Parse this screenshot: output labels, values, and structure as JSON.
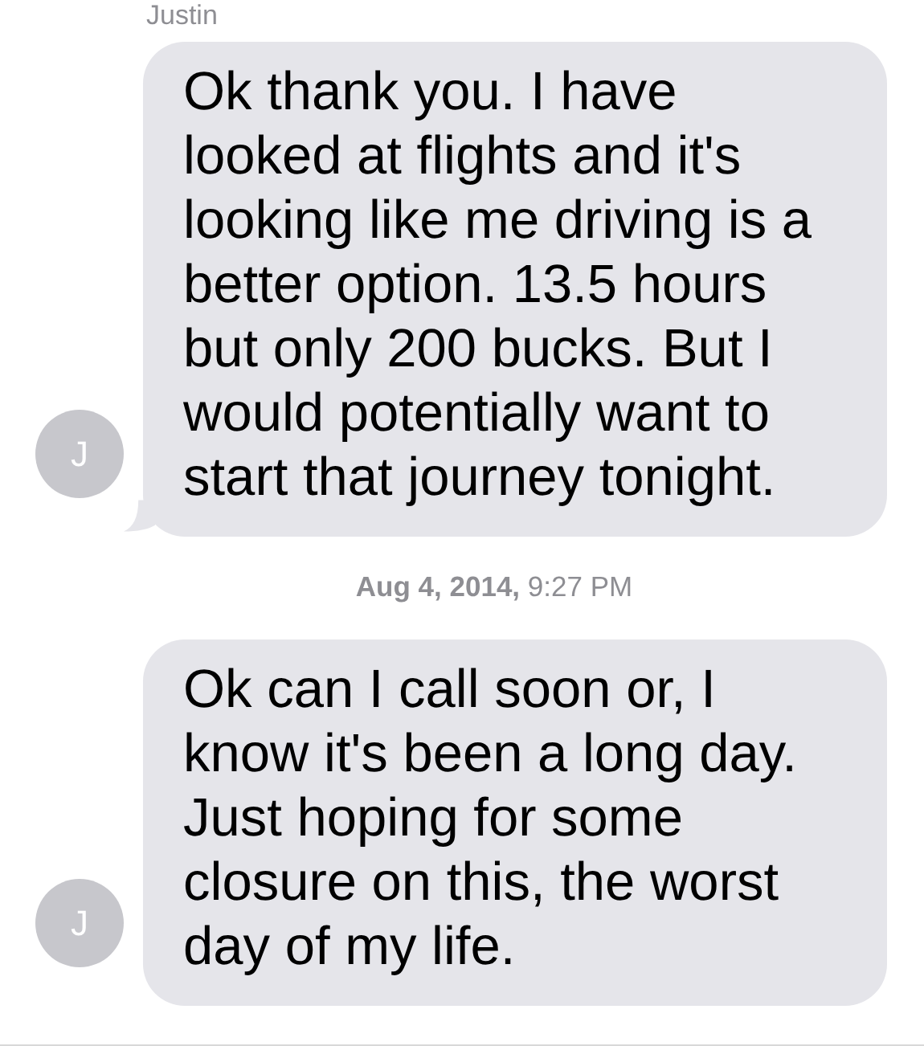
{
  "sender_name": "Justin",
  "messages": [
    {
      "kind": "message",
      "text": "Ok thank you. I have looked at flights and it's looking like me driving is a better option. 13.5 hours but only 200 bucks. But I would potentially want to start that journey tonight.",
      "avatar": "J",
      "tail": true
    },
    {
      "kind": "timestamp",
      "text": "**Aug 4, 2014,** 9:27 PM"
    },
    {
      "kind": "message",
      "text": "Ok can I call soon or, I know it's been a long day. Just hoping for some closure on this, the worst day of my life.",
      "avatar": "J",
      "tail": false
    }
  ]
}
